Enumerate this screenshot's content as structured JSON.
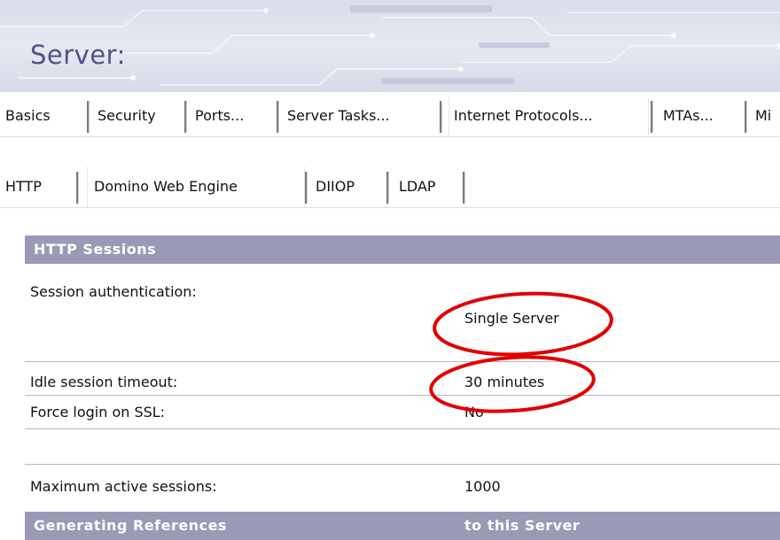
{
  "banner": {
    "title": "Server:"
  },
  "tabs_main": [
    {
      "label": "Basics"
    },
    {
      "label": "Security"
    },
    {
      "label": "Ports..."
    },
    {
      "label": "Server Tasks..."
    },
    {
      "label": "Internet Protocols..."
    },
    {
      "label": "MTAs..."
    },
    {
      "label": "Mi"
    }
  ],
  "tabs_sub": [
    {
      "label": "HTTP"
    },
    {
      "label": "Domino Web Engine"
    },
    {
      "label": "DIIOP"
    },
    {
      "label": "LDAP"
    }
  ],
  "http_sessions": {
    "header": "HTTP Sessions",
    "rows": [
      {
        "label": "Session authentication:",
        "value": "Single Server"
      },
      {
        "label": "Idle session timeout:",
        "value": "30 minutes"
      },
      {
        "label": "Force login on SSL:",
        "value": "No"
      },
      {
        "label": "Maximum active sessions:",
        "value": "1000"
      }
    ]
  },
  "generating_references": {
    "header_left": "Generating References",
    "header_right": "to this Server"
  },
  "colors": {
    "section_header_bg": "#9a9ab7",
    "banner_title": "#4d5486",
    "annotation_ellipse": "#e00000"
  }
}
